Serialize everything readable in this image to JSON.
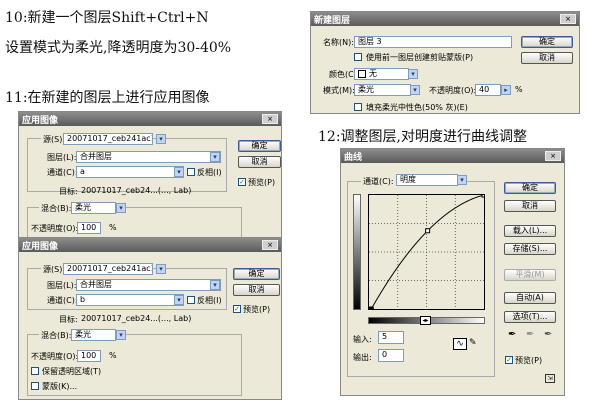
{
  "steps": {
    "step10_line1": "10:新建一个图层Shift+Ctrl+N",
    "step10_line2": "设置模式为柔光,降透明度为30-40%",
    "step11": "11:在新建的图层上进行应用图像",
    "step12": "12:调整图层,对明度进行曲线调整"
  },
  "new_layer": {
    "title": "新建图层",
    "close": "×",
    "name_label": "名称(N):",
    "name_value": "图层 3",
    "clip_label": "使用前一图层创建剪贴蒙版(P)",
    "color_label": "颜色(C):",
    "color_value": "无",
    "mode_label": "模式(M):",
    "mode_value": "柔光",
    "opacity_label": "不透明度(O):",
    "opacity_value": "40",
    "percent": "%",
    "fill_label": "填充柔光中性色(50% 灰)(E)",
    "ok": "确定",
    "cancel": "取消"
  },
  "apply1": {
    "title": "应用图像",
    "close": "×",
    "source_label": "源(S):",
    "source_value": "20071017_ceb241ac11...",
    "layer_label": "图层(L):",
    "layer_value": "合并图层",
    "channel_label": "通道(C):",
    "channel_value": "a",
    "invert_label": "反相(I)",
    "target_label": "目标:",
    "target_value": "20071017_ceb24...(..., Lab)",
    "blend_label": "混合(B):",
    "blend_value": "柔光",
    "opacity_label": "不透明度(O):",
    "opacity_value": "100",
    "percent": "%",
    "ok": "确定",
    "cancel": "取消",
    "preview_label": "预览(P)"
  },
  "apply2": {
    "title": "应用图像",
    "close": "×",
    "source_label": "源(S):",
    "source_value": "20071017_ceb241ac11...",
    "layer_label": "图层(L):",
    "layer_value": "合并图层",
    "channel_label": "通道(C):",
    "channel_value": "b",
    "invert_label": "反相(I)",
    "target_label": "目标:",
    "target_value": "20071017_ceb24...(..., Lab)",
    "blend_label": "混合(B):",
    "blend_value": "柔光",
    "opacity_label": "不透明度(O):",
    "opacity_value": "100",
    "percent": "%",
    "preserve_label": "保留透明区域(T)",
    "mask_label": "蒙版(K)...",
    "ok": "确定",
    "cancel": "取消",
    "preview_label": "预览(P)"
  },
  "curves": {
    "title": "曲线",
    "close": "×",
    "channel_label": "通道(C):",
    "channel_value": "明度",
    "input_label": "输入:",
    "input_value": "5",
    "output_label": "输出:",
    "output_value": "0",
    "buttons": [
      "确定",
      "取消",
      "载入(L)...",
      "存储(S)...",
      "平滑(M)",
      "自动(A)",
      "选项(T)..."
    ],
    "preview_label": "预览(P)",
    "curve_points": [
      [
        5,
        0
      ],
      [
        130,
        175
      ],
      [
        255,
        255
      ]
    ]
  }
}
